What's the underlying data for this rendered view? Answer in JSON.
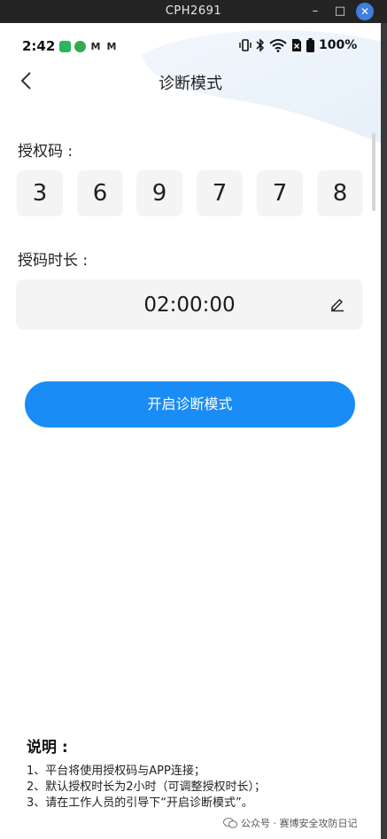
{
  "window": {
    "title": "CPH2691"
  },
  "status_bar": {
    "time": "2:42",
    "battery": "100%"
  },
  "header": {
    "title": "诊断模式"
  },
  "auth_code": {
    "label": "授权码 :",
    "digits": [
      "3",
      "6",
      "9",
      "7",
      "7",
      "8"
    ]
  },
  "duration": {
    "label": "授码时长 :",
    "value": "02:00:00"
  },
  "start_button": {
    "label": "开启诊断模式"
  },
  "notes": {
    "title": "说明 :",
    "items": [
      "1、平台将使用授权码与APP连接；",
      "2、默认授权时长为2小时（可调整授权时长）；",
      "3、请在工作人员的引导下“开启诊断模式”。"
    ]
  },
  "watermark": {
    "text": "公众号 · 赛博安全攻防日记"
  },
  "colors": {
    "accent": "#1a8cf5",
    "field_bg": "#f4f4f4"
  }
}
